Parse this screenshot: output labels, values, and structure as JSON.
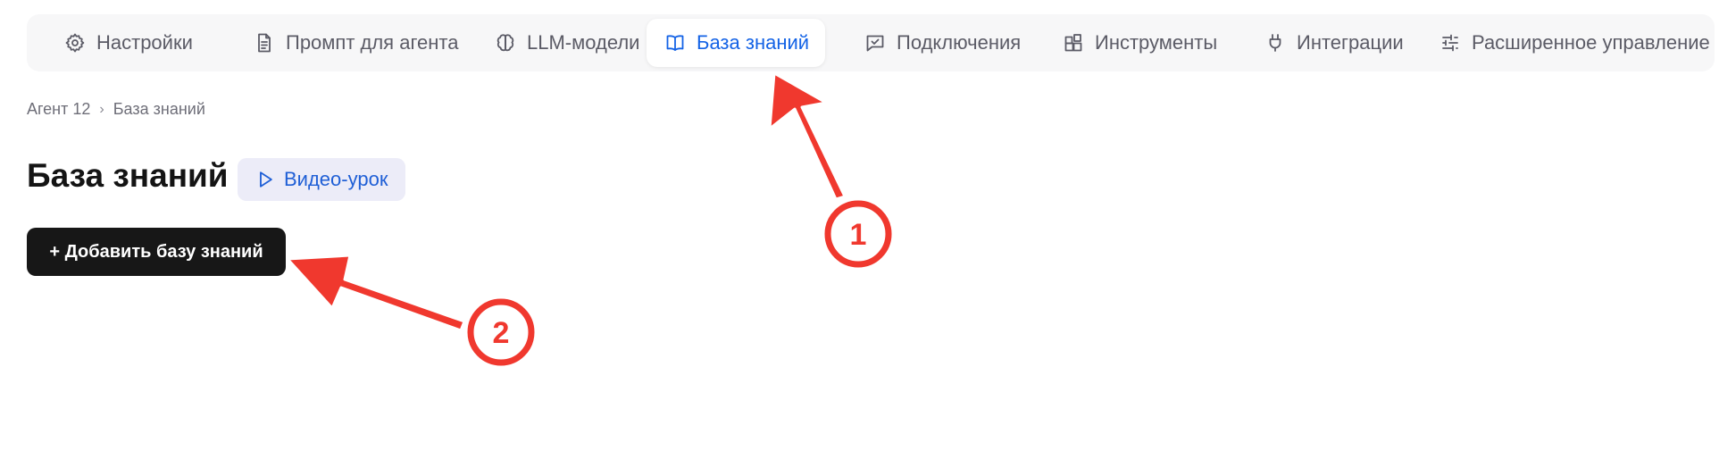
{
  "tabs": [
    {
      "label": "Настройки",
      "icon": "gear-icon",
      "active": false
    },
    {
      "label": "Промпт для агента",
      "icon": "document-icon",
      "active": false
    },
    {
      "label": "LLM-модели",
      "icon": "brain-icon",
      "active": false
    },
    {
      "label": "База знаний",
      "icon": "book-icon",
      "active": true
    },
    {
      "label": "Подключения",
      "icon": "chat-check-icon",
      "active": false
    },
    {
      "label": "Инструменты",
      "icon": "blocks-icon",
      "active": false
    },
    {
      "label": "Интеграции",
      "icon": "plug-icon",
      "active": false
    },
    {
      "label": "Расширенное управление",
      "icon": "sliders-icon",
      "active": false
    }
  ],
  "breadcrumb": {
    "parent": "Агент 12",
    "separator": "›",
    "current": "База знаний"
  },
  "page": {
    "title": "База знаний",
    "video_label": "Видео-урок",
    "add_label": "+ Добавить базу знаний"
  },
  "annotations": {
    "badge_1": "1",
    "badge_2": "2"
  },
  "colors": {
    "accent": "#1463e6",
    "annotation": "#f0382e",
    "primary_button": "#171717",
    "video_button_bg": "#ececf8"
  }
}
